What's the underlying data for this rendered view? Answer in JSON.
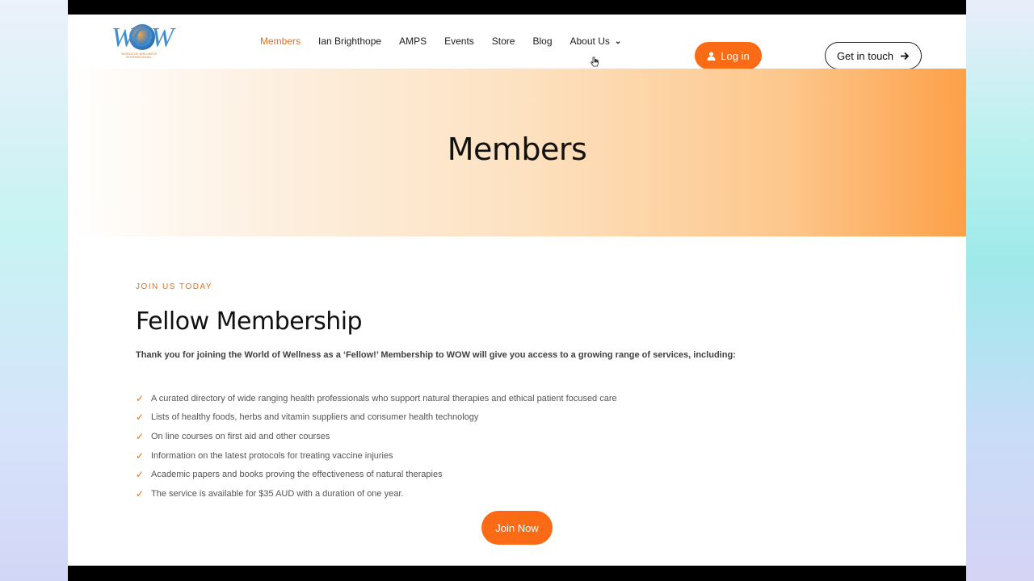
{
  "logo": {
    "wordmark": "WOW",
    "tagline_line1": "WORLD OF WELLNESS",
    "tagline_line2": "INTERNATIONAL"
  },
  "nav": {
    "items": [
      {
        "label": "Members",
        "active": true
      },
      {
        "label": "Ian Brighthope"
      },
      {
        "label": "AMPS"
      },
      {
        "label": "Events"
      },
      {
        "label": "Store"
      },
      {
        "label": "Blog"
      },
      {
        "label": "About Us"
      }
    ]
  },
  "header": {
    "login_label": "Log in",
    "contact_label": "Get in touch"
  },
  "hero": {
    "title": "Members"
  },
  "main": {
    "eyebrow": "JOIN US TODAY",
    "heading": "Fellow Membership",
    "intro": "Thank you for joining the World of Wellness as a ‘Fellow!’ Membership to WOW will give you access to a growing range of services, including:",
    "features": [
      "A curated directory of wide ranging health professionals who support natural therapies and ethical patient focused care",
      "Lists of healthy foods, herbs and vitamin suppliers and consumer health technology",
      "On line courses on first aid and other courses",
      "Information on the latest protocols for treating vaccine injuries",
      "Academic papers and books proving the effectiveness of natural therapies",
      "The service is available for $35 AUD with a duration of one year."
    ],
    "join_label": "Join Now"
  },
  "colors": {
    "accent": "#fb6a14",
    "accent_text": "#e2711d"
  }
}
